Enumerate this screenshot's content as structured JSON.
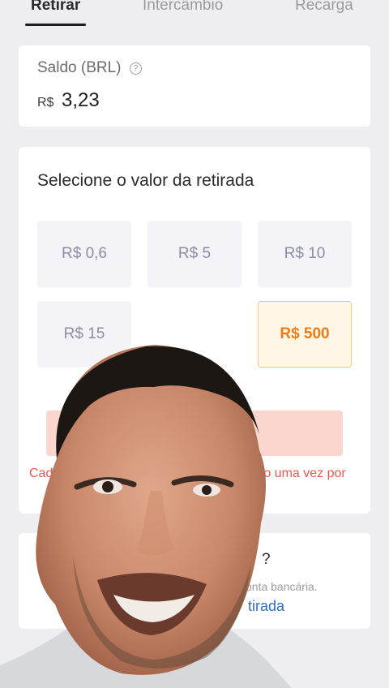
{
  "tabs": [
    {
      "label": "Retirar",
      "active": true
    },
    {
      "label": "Intercâmbio",
      "active": false
    },
    {
      "label": "Recarga",
      "active": false
    }
  ],
  "balance": {
    "label": "Saldo (BRL)",
    "currency": "R$",
    "value": "3,23"
  },
  "withdraw": {
    "title": "Selecione o valor da retirada",
    "amounts": [
      "R$ 0,6",
      "R$ 5",
      "R$ 10",
      "R$ 15",
      "R$ 500"
    ],
    "selected_amount": "R$ 500",
    "notice_left": "Cad",
    "notice_right": "ro uma vez por"
  },
  "bank": {
    "question": "?",
    "description": "onta bancária.",
    "link": "tirada"
  },
  "colors": {
    "accent": "#f07a13",
    "warning": "#f0584a",
    "link": "#2f6ec2"
  },
  "icons": {
    "help": "question-circle-icon"
  }
}
